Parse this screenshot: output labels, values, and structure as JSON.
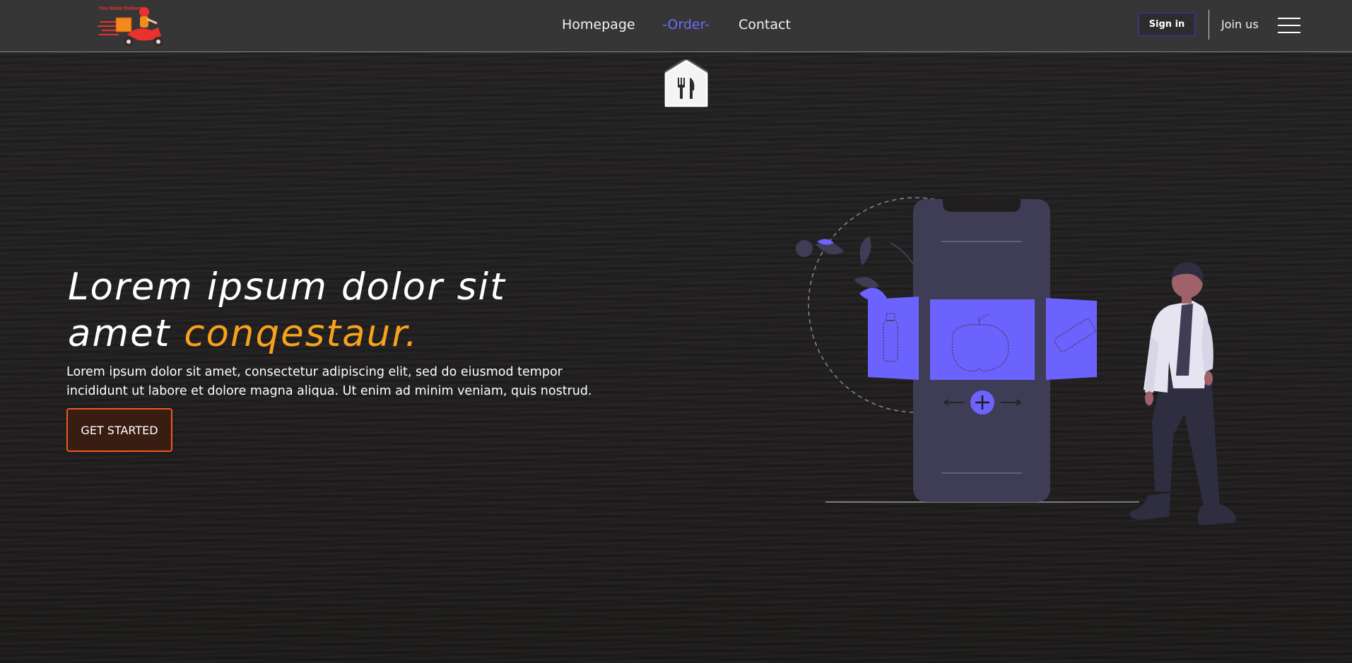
{
  "brand": {
    "logo_icon": "scooter-delivery-logo",
    "logo_text": "You Name Delivery"
  },
  "nav": {
    "items": [
      {
        "label": "Homepage",
        "active": false
      },
      {
        "label": "-Order-",
        "active": true
      },
      {
        "label": "Contact",
        "active": false
      }
    ],
    "sign_in": "Sign in",
    "join_us": "Join us",
    "menu_icon": "hamburger-icon"
  },
  "tab_icon": "fork-knife-icon",
  "hero": {
    "title_part1": "Lorem ipsum dolor sit",
    "title_part2": "amet ",
    "title_highlight": "conqestaur.",
    "description_line1": "Lorem ipsum dolor sit amet, consectetur adipiscing elit, sed do eiusmod tempor",
    "description_line2": "incididunt ut labore et dolore magna aliqua. Ut enim ad minim veniam, quis nostrud.",
    "cta": "GET STARTED"
  },
  "colors": {
    "accent": "#f6a21e",
    "active_nav": "#6a6cff",
    "cta_border": "#ea5a23",
    "illustration_primary": "#6c63ff",
    "phone": "#3f3d56"
  },
  "illustration": {
    "icon": "mobile-order-illustration"
  }
}
